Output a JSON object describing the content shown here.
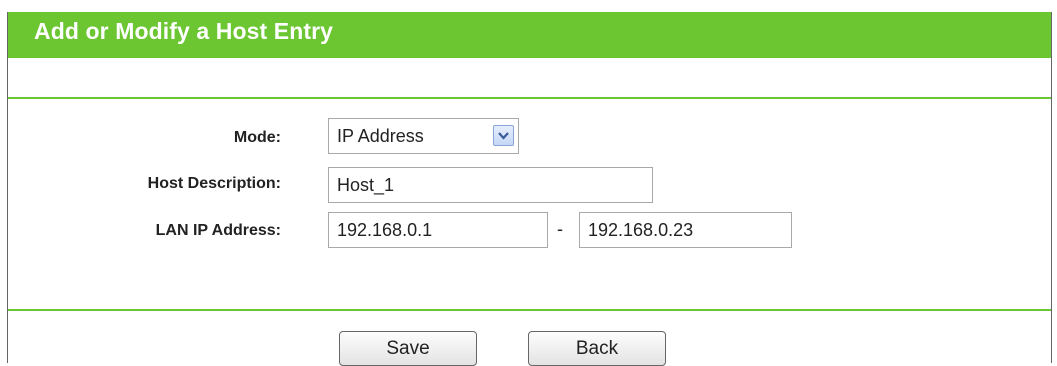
{
  "panel": {
    "title": "Add or Modify a Host Entry"
  },
  "form": {
    "mode": {
      "label": "Mode:",
      "selected": "IP Address",
      "icon": "chevron-down-icon"
    },
    "host_description": {
      "label": "Host Description:",
      "value": "Host_1"
    },
    "lan_ip": {
      "label": "LAN IP Address:",
      "start": "192.168.0.1",
      "separator": "-",
      "end": "192.168.0.23"
    }
  },
  "buttons": {
    "save": "Save",
    "back": "Back"
  },
  "colors": {
    "accent_green": "#6bc632",
    "title_text": "#ffffff"
  }
}
